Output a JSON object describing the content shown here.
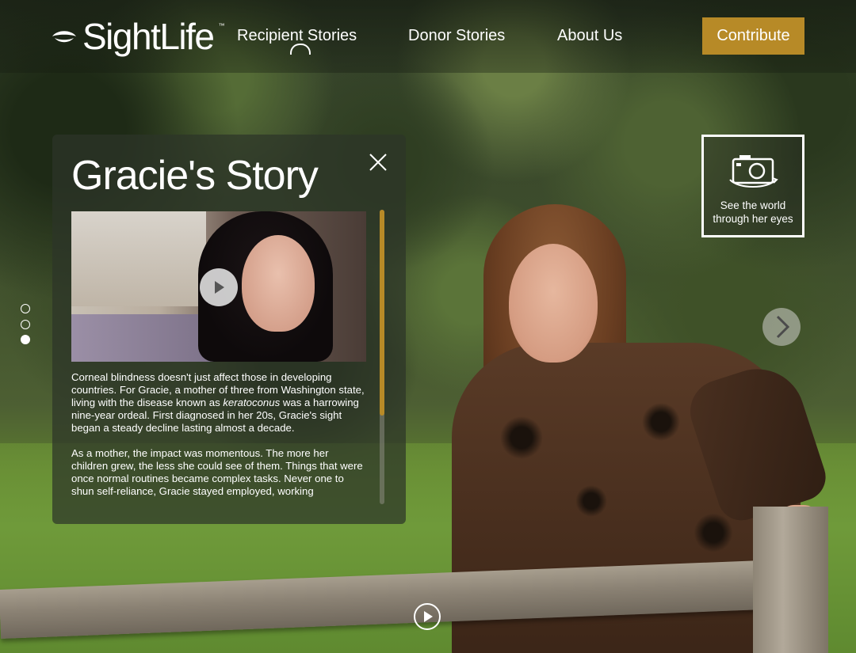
{
  "brand": {
    "name": "SightLife",
    "trademark": "™"
  },
  "nav": {
    "items": [
      {
        "label": "Recipient Stories"
      },
      {
        "label": "Donor Stories"
      },
      {
        "label": "About Us"
      }
    ],
    "contribute_label": "Contribute",
    "accent_color": "#b78a27"
  },
  "story": {
    "title": "Gracie's Story",
    "close_icon": "close-icon",
    "video_play_icon": "play-icon",
    "paragraph1_part1": "Corneal blindness doesn't just affect those in developing countries. For Gracie, a mother of three from Washington state, living with the disease known as ",
    "paragraph1_emphasis": "keratoconus",
    "paragraph1_part2": " was a harrowing nine-year ordeal. First diagnosed in her 20s, Gracie's sight began a steady decline lasting almost a decade.",
    "paragraph2": "As a mother, the impact was momentous. The more her children grew, the less she could see of them. Things that were once normal routines became complex tasks. Never one to shun self-reliance, Gracie stayed employed, working",
    "scroll_position": 0.7
  },
  "slider": {
    "dots": 3,
    "active_index": 2
  },
  "see_world": {
    "icon": "camera-icon",
    "line1": "See the world",
    "line2": "through her eyes"
  },
  "controls": {
    "next_icon": "chevron-right-icon",
    "bottom_play_icon": "play-circle-icon"
  }
}
